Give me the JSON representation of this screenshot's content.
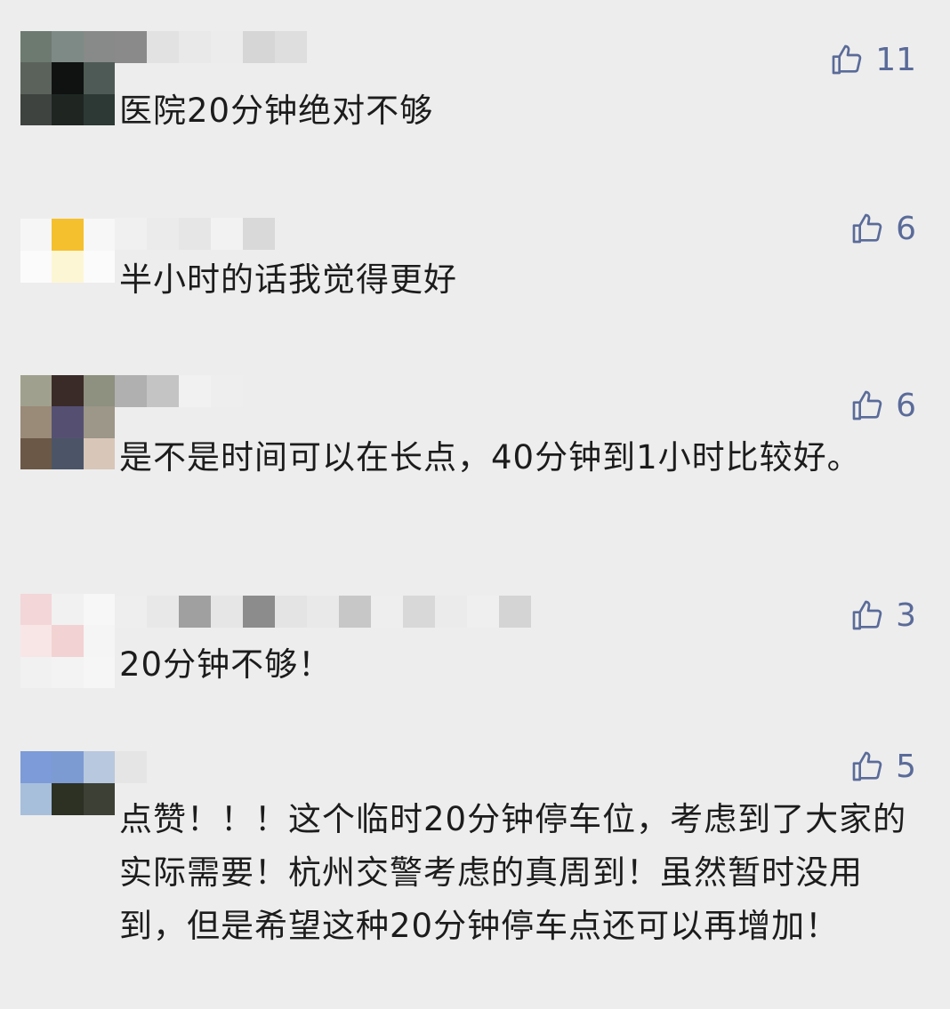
{
  "accent_color": "#5a6b99",
  "comments": [
    {
      "likes": "11",
      "text": "医院20分钟绝对不够"
    },
    {
      "likes": "6",
      "text": "半小时的话我觉得更好"
    },
    {
      "likes": "6",
      "text": "是不是时间可以在长点，40分钟到1小时比较好。"
    },
    {
      "likes": "3",
      "text": "20分钟不够！"
    },
    {
      "likes": "5",
      "text": "点赞！！！这个临时20分钟停车位，考虑到了大家的实际需要！杭州交警考虑的真周到！虽然暂时没用到，但是希望这种20分钟停车点还可以再增加！"
    }
  ],
  "icons": {
    "like": "thumbs-up-icon"
  }
}
